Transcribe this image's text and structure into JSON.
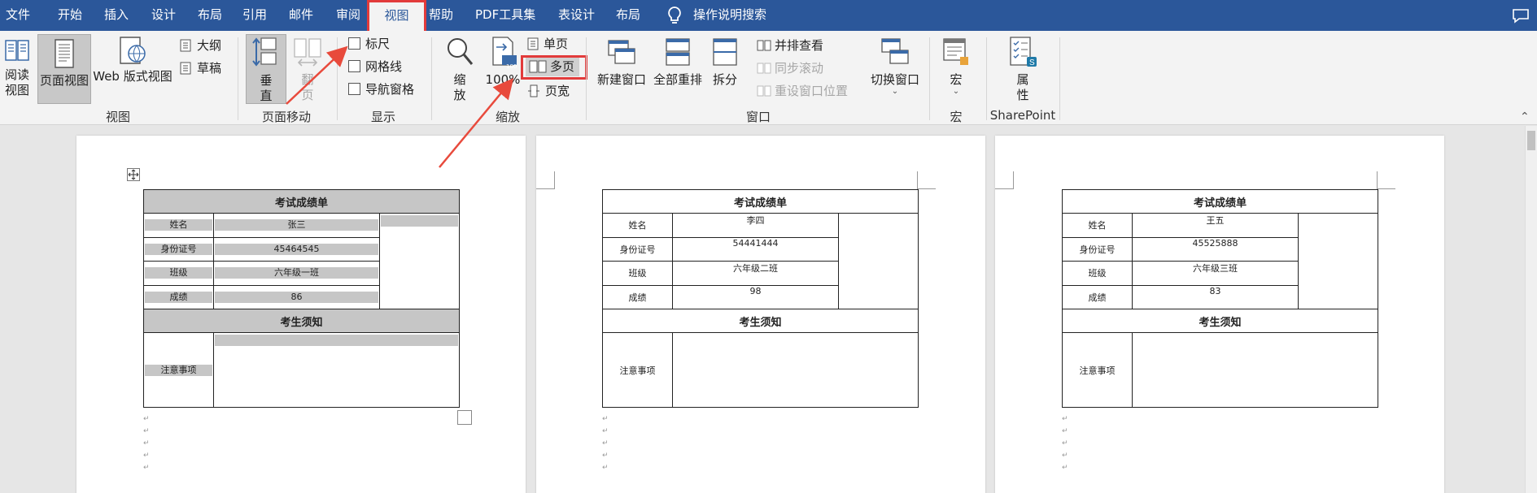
{
  "menubar": {
    "items": [
      "文件",
      "开始",
      "插入",
      "设计",
      "布局",
      "引用",
      "邮件",
      "审阅",
      "视图",
      "帮助",
      "PDF工具集",
      "表设计",
      "布局"
    ],
    "active": "视图",
    "search": "操作说明搜索"
  },
  "ribbon": {
    "view_group": {
      "label": "视图",
      "read_mode": "阅读视图",
      "read_line1": "阅读",
      "read_line2": "视图",
      "page_view": "页面视图",
      "web_view": "Web 版式视图",
      "outline": "大纲",
      "draft": "草稿"
    },
    "page_move_group": {
      "label": "页面移动",
      "vertical_line1": "垂",
      "vertical_line2": "直",
      "side_line1": "翻",
      "side_line2": "页"
    },
    "show_group": {
      "label": "显示",
      "ruler": "标尺",
      "gridlines": "网格线",
      "nav_pane": "导航窗格"
    },
    "zoom_group": {
      "label": "缩放",
      "zoom_line1": "缩",
      "zoom_line2": "放",
      "zoom100": "100%",
      "zoom100_badge": "100",
      "one_page": "单页",
      "multi_page": "多页",
      "page_width": "页宽"
    },
    "window_group": {
      "label": "窗口",
      "new_window": "新建窗口",
      "arrange_all": "全部重排",
      "split": "拆分",
      "side_by_side": "并排查看",
      "sync_scroll": "同步滚动",
      "reset_pos": "重设窗口位置",
      "switch_window": "切换窗口"
    },
    "macro_group": {
      "label": "宏",
      "macro": "宏"
    },
    "sharepoint_group": {
      "label": "SharePoint",
      "props_line1": "属",
      "props_line2": "性"
    }
  },
  "labels": {
    "title": "考试成绩单",
    "name": "姓名",
    "id": "身份证号",
    "class": "班级",
    "score": "成绩",
    "notice": "考生须知",
    "notes": "注意事项"
  },
  "pages": [
    {
      "name": "张三",
      "id": "45464545",
      "class": "六年级一班",
      "score": "86"
    },
    {
      "name": "李四",
      "id": "54441444",
      "class": "六年级二班",
      "score": "98"
    },
    {
      "name": "王五",
      "id": "45525888",
      "class": "六年级三班",
      "score": "83"
    }
  ],
  "colors": {
    "menubar": "#2b579a",
    "ribbon": "#f3f3f3",
    "highlight": "#e23b3b",
    "arrow": "#e84a3c"
  },
  "icons": [
    "move-handle-icon",
    "search-lightbulb-icon",
    "comment-icon",
    "magnifier-icon"
  ]
}
